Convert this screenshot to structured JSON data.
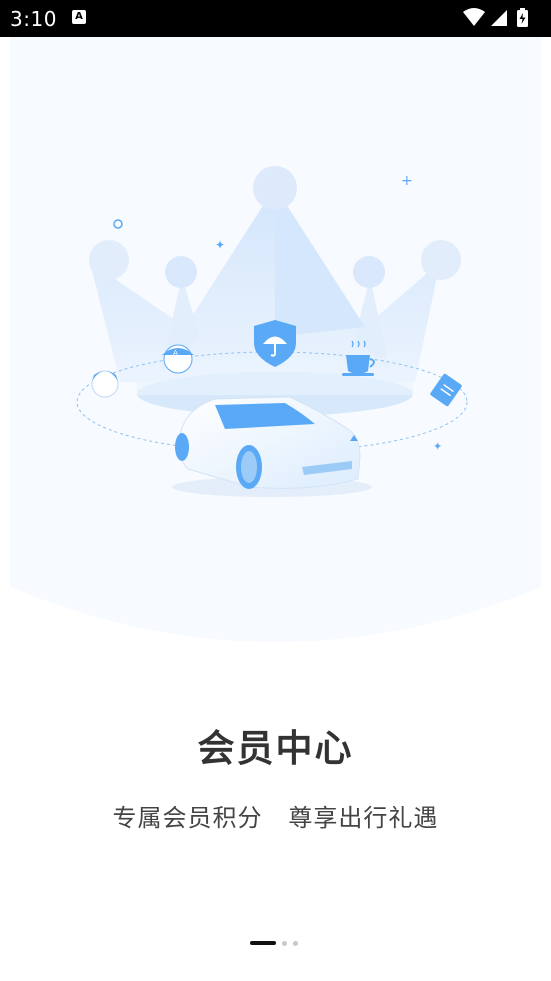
{
  "status_bar": {
    "time": "3:10",
    "notification_icon": "a-letter-icon",
    "icons": [
      "wifi-icon",
      "signal-icon",
      "battery-charging-icon"
    ]
  },
  "hero": {
    "illustration": "vip-crown-car-illustration",
    "accent_color": "#5aa9f6",
    "background_color": "#f7fafe"
  },
  "content": {
    "title": "会员中心",
    "subtitle": "专属会员积分   尊享出行礼遇"
  },
  "pager": {
    "page_count": 3,
    "current_page": 1
  }
}
